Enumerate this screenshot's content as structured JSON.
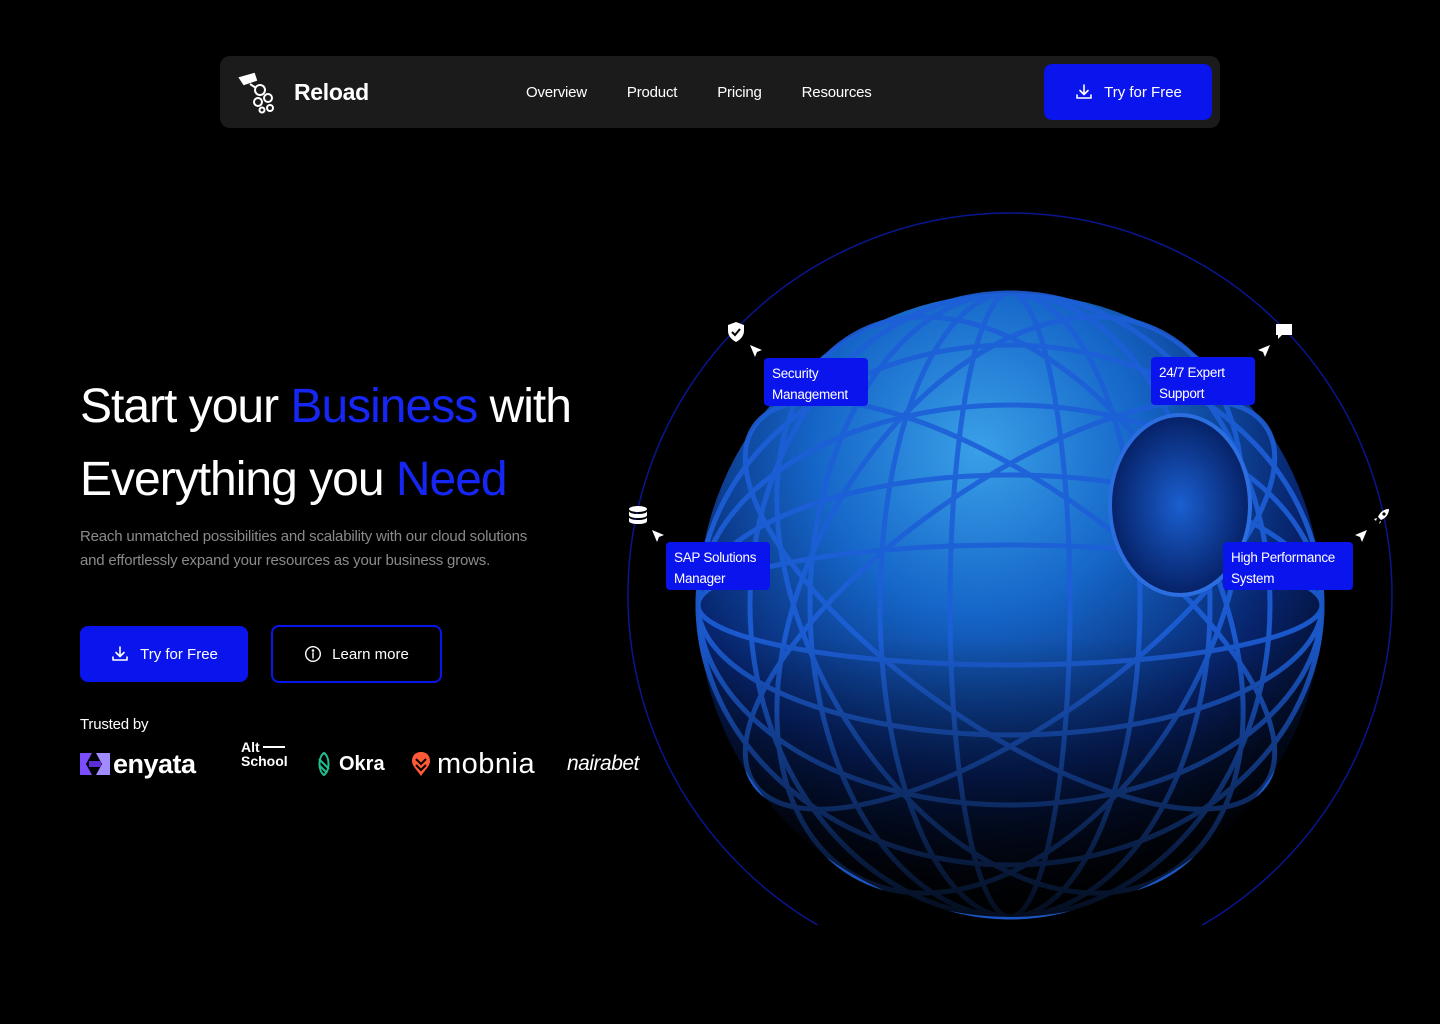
{
  "nav": {
    "brand": "Reload",
    "items": [
      "Overview",
      "Product",
      "Pricing",
      "Resources"
    ],
    "cta": "Try for Free"
  },
  "hero": {
    "line1_a": "Start your ",
    "line1_accent": "Business",
    "line1_b": " with",
    "line2_a": "Everything you ",
    "line2_accent": "Need",
    "subtitle": "Reach unmatched possibilities and scalability with our cloud solutions and effortlessly expand your resources as your business grows.",
    "primary_cta": "Try for Free",
    "secondary_cta": "Learn more",
    "trusted_label": "Trusted by"
  },
  "logos": {
    "enyata": "enyata",
    "altschool_1": "Alt",
    "altschool_2": "School",
    "okra": "Okra",
    "mobnia": "mobnia",
    "nairabet": "nairabet"
  },
  "features": {
    "security_1": "Security",
    "security_2": "Management",
    "support_1": "24/7 Expert",
    "support_2": "Support",
    "sap_1": "SAP Solutions",
    "sap_2": "Manager",
    "hp_1": "High Performance",
    "hp_2": "System"
  },
  "colors": {
    "accent": "#0a14ec",
    "background": "#000000",
    "nav_bg": "#1b1b1b",
    "muted_text": "#8a8a8a"
  },
  "icons": [
    "brand-logo-icon",
    "download-icon",
    "info-icon",
    "shield-check-icon",
    "chat-icon",
    "database-icon",
    "rocket-icon",
    "cursor-icon"
  ]
}
